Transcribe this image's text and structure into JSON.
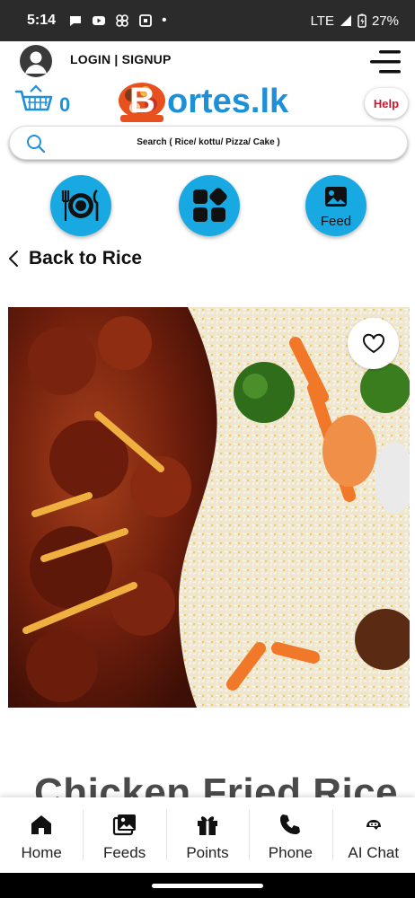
{
  "status_bar": {
    "time": "5:14",
    "dot": "•",
    "network": "LTE",
    "battery": "27%"
  },
  "header": {
    "login_label": "LOGIN | SIGNUP",
    "cart_count": "0",
    "logo_text": "ortes.lk",
    "logo_letter": "B",
    "help_label": "Help"
  },
  "search": {
    "placeholder": "Search ( Rice/ kottu/ Pizza/ Cake )"
  },
  "quick_actions": {
    "feed_label": "Feed"
  },
  "navigation": {
    "back_label": "Back to Rice"
  },
  "product": {
    "title": "Chicken Fried Rice"
  },
  "bottom_nav": {
    "items": [
      {
        "label": "Home",
        "icon": "home-icon"
      },
      {
        "label": "Feeds",
        "icon": "images-icon"
      },
      {
        "label": "Points",
        "icon": "gift-icon"
      },
      {
        "label": "Phone",
        "icon": "phone-icon"
      },
      {
        "label": "AI Chat",
        "icon": "ai-chat-icon"
      }
    ]
  },
  "colors": {
    "accent_blue": "#18a9e3",
    "help_red": "#d4142a",
    "logo_blue": "#1e90d8",
    "logo_orange": "#e8501e"
  }
}
